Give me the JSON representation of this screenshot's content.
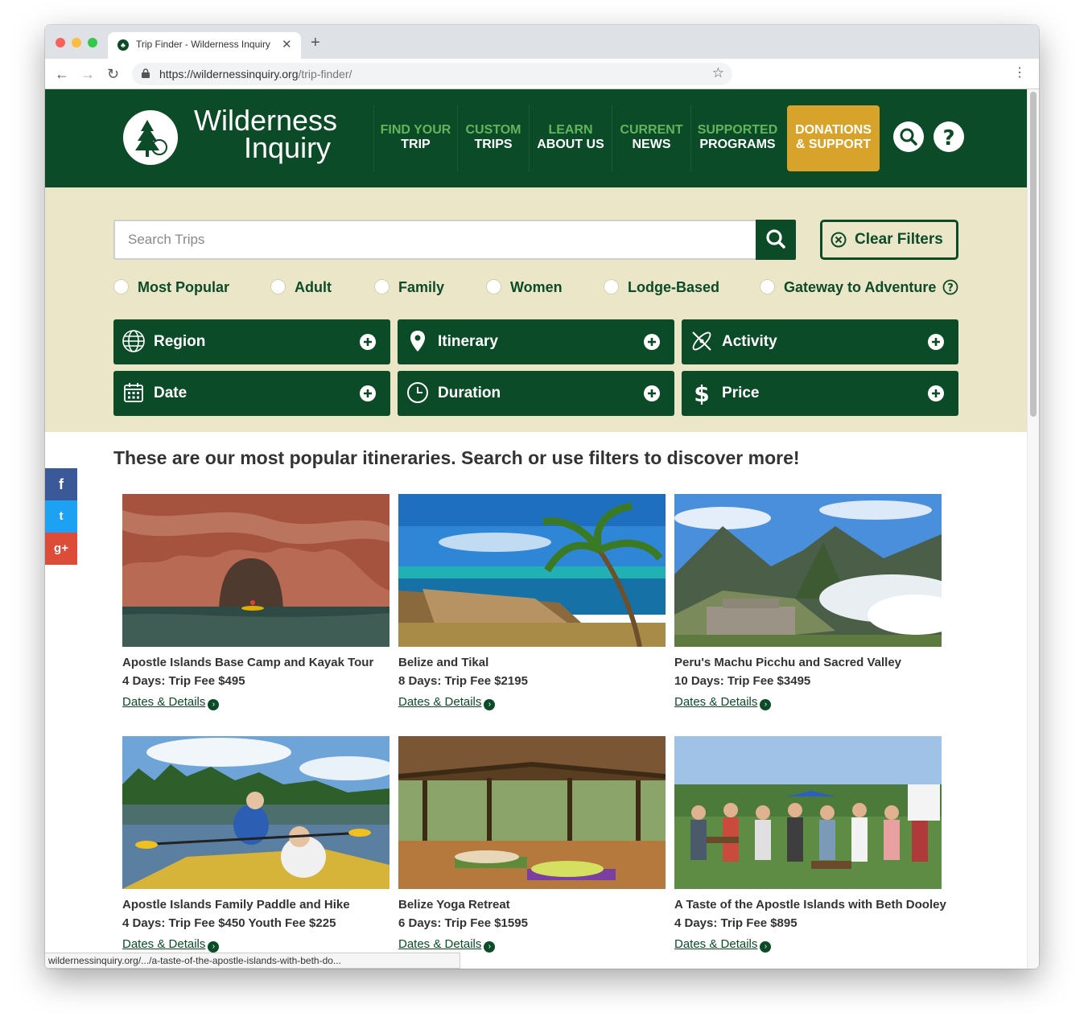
{
  "browser": {
    "tab_title": "Trip Finder - Wilderness Inquiry",
    "url_host": "https://wildernessinquiry.org",
    "url_path": "/trip-finder/",
    "status_url": "wildernessinquiry.org/.../a-taste-of-the-apostle-islands-with-beth-do..."
  },
  "header": {
    "logo_line1": "Wilderness",
    "logo_line2": "Inquiry",
    "nav": [
      {
        "top": "FIND YOUR",
        "bottom": "TRIP"
      },
      {
        "top": "CUSTOM",
        "bottom": "TRIPS"
      },
      {
        "top": "LEARN",
        "bottom": "ABOUT US"
      },
      {
        "top": "CURRENT",
        "bottom": "NEWS"
      },
      {
        "top": "SUPPORTED",
        "bottom": "PROGRAMS"
      }
    ],
    "donate_line1": "DONATIONS",
    "donate_line2": "& SUPPORT"
  },
  "filters": {
    "search_placeholder": "Search Trips",
    "clear_label": "Clear Filters",
    "categories": [
      "Most Popular",
      "Adult",
      "Family",
      "Women",
      "Lodge-Based",
      "Gateway to Adventure"
    ],
    "buttons": [
      "Region",
      "Itinerary",
      "Activity",
      "Date",
      "Duration",
      "Price"
    ]
  },
  "main": {
    "headline": "These are our most popular itineraries. Search or use filters to discover more!",
    "link_label": "Dates & Details",
    "trips": [
      {
        "name": "Apostle Islands Base Camp and Kayak Tour",
        "fee": "4 Days: Trip Fee $495"
      },
      {
        "name": "Belize and Tikal",
        "fee": "8 Days: Trip Fee $2195"
      },
      {
        "name": "Peru's Machu Picchu and Sacred Valley",
        "fee": "10 Days: Trip Fee $3495"
      },
      {
        "name": "Apostle Islands Family Paddle and Hike",
        "fee": "4 Days: Trip Fee $450 Youth Fee $225"
      },
      {
        "name": "Belize Yoga Retreat",
        "fee": "6 Days: Trip Fee $1595"
      },
      {
        "name": "A Taste of the Apostle Islands with Beth Dooley",
        "fee": "4 Days: Trip Fee $895"
      }
    ]
  },
  "social": [
    "f",
    "t",
    "g+"
  ],
  "colors": {
    "brand_green": "#0c4b27",
    "nav_accent": "#63b45c",
    "donate": "#d8a32b",
    "filter_bg": "#ebe6c7"
  }
}
